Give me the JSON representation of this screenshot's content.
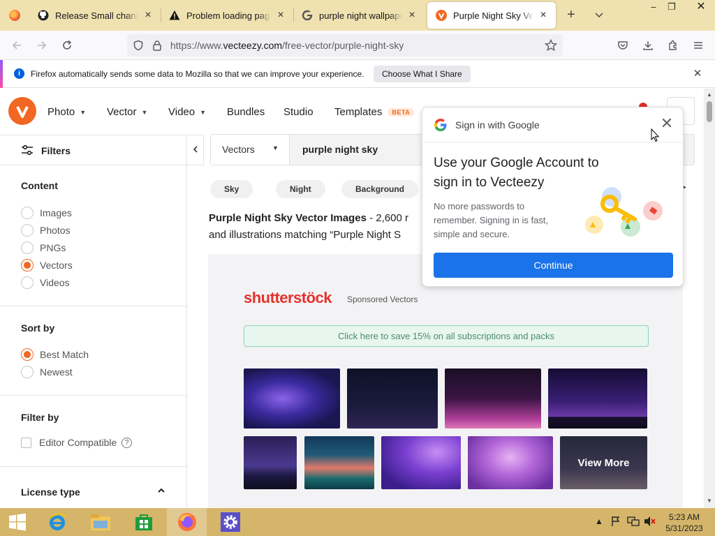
{
  "browser": {
    "tabs": [
      {
        "title": "Release Small changes ·",
        "icon": "github-icon"
      },
      {
        "title": "Problem loading page",
        "icon": "warning-icon"
      },
      {
        "title": "purple night wallpaper -",
        "icon": "google-icon"
      },
      {
        "title": "Purple Night Sky Vector",
        "icon": "vecteezy-icon",
        "active": true
      }
    ],
    "url_prefix": "https://www.",
    "url_host": "vecteezy.com",
    "url_path": "/free-vector/purple-night-sky",
    "notification": {
      "message": "Firefox automatically sends some data to Mozilla so that we can improve your experience.",
      "button": "Choose What I Share"
    }
  },
  "site": {
    "accent": "#f26722",
    "nav": {
      "photo": "Photo",
      "vector": "Vector",
      "video": "Video",
      "bundles": "Bundles",
      "studio": "Studio",
      "templates": "Templates",
      "beta": "BETA"
    },
    "sidebar": {
      "title": "Filters",
      "content": {
        "title": "Content",
        "options": [
          "Images",
          "Photos",
          "PNGs",
          "Vectors",
          "Videos"
        ],
        "selected": "Vectors"
      },
      "sort": {
        "title": "Sort by",
        "options": [
          "Best Match",
          "Newest"
        ],
        "selected": "Best Match"
      },
      "filter_by": {
        "title": "Filter by",
        "option": "Editor Compatible",
        "help": "?"
      },
      "license": {
        "title": "License type"
      }
    },
    "search": {
      "type": "Vectors",
      "query": "purple night sky"
    },
    "chips": [
      "Sky",
      "Night",
      "Background"
    ],
    "results": {
      "title_bold": "Purple Night Sky Vector Images",
      "title_rest": " - 2,600 r",
      "line2": "and illustrations matching “Purple Night S"
    },
    "sponsored": {
      "brand": "shutterstöck",
      "label": "Sponsored Vectors",
      "promo": "Click here to save 15% on all subscriptions and packs",
      "view_more": "View More"
    }
  },
  "google_popup": {
    "header": "Sign in with Google",
    "title": "Use your Google Account to sign in to Vecteezy",
    "description": "No more passwords to remember. Signing in is fast, simple and secure.",
    "button": "Continue"
  },
  "taskbar": {
    "time": "5:23 AM",
    "date": "5/31/2023"
  }
}
